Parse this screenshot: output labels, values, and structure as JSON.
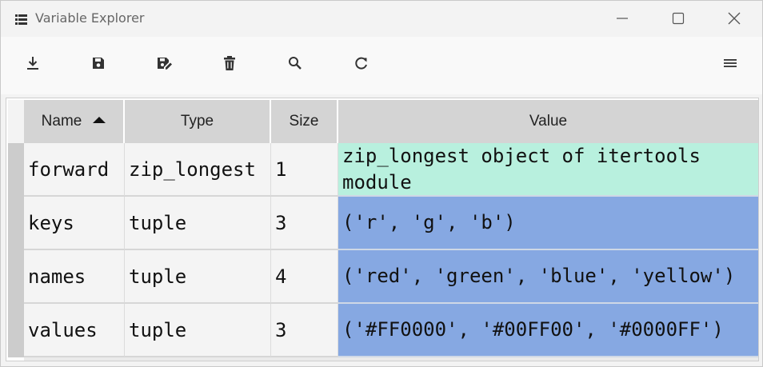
{
  "window": {
    "title": "Variable Explorer"
  },
  "toolbar": {
    "buttons": [
      {
        "icon": "download-icon"
      },
      {
        "icon": "save-icon"
      },
      {
        "icon": "save-as-icon"
      },
      {
        "icon": "delete-icon"
      },
      {
        "icon": "search-icon"
      },
      {
        "icon": "refresh-icon"
      },
      {
        "icon": "options-menu-icon"
      }
    ]
  },
  "table": {
    "headers": {
      "name": "Name",
      "type": "Type",
      "size": "Size",
      "value": "Value"
    },
    "sort": {
      "column": "Name",
      "direction": "ascending"
    },
    "rows": [
      {
        "name": "forward",
        "type": "zip_longest",
        "size": "1",
        "value": "zip_longest object of itertools module",
        "value_bg": "#b8f0de"
      },
      {
        "name": "keys",
        "type": "tuple",
        "size": "3",
        "value": "('r', 'g', 'b')",
        "value_bg": "#86a8e2"
      },
      {
        "name": "names",
        "type": "tuple",
        "size": "4",
        "value": "('red', 'green', 'blue', 'yellow')",
        "value_bg": "#86a8e2"
      },
      {
        "name": "values",
        "type": "tuple",
        "size": "3",
        "value": "('#FF0000', '#00FF00', '#0000FF')",
        "value_bg": "#86a8e2"
      }
    ]
  }
}
